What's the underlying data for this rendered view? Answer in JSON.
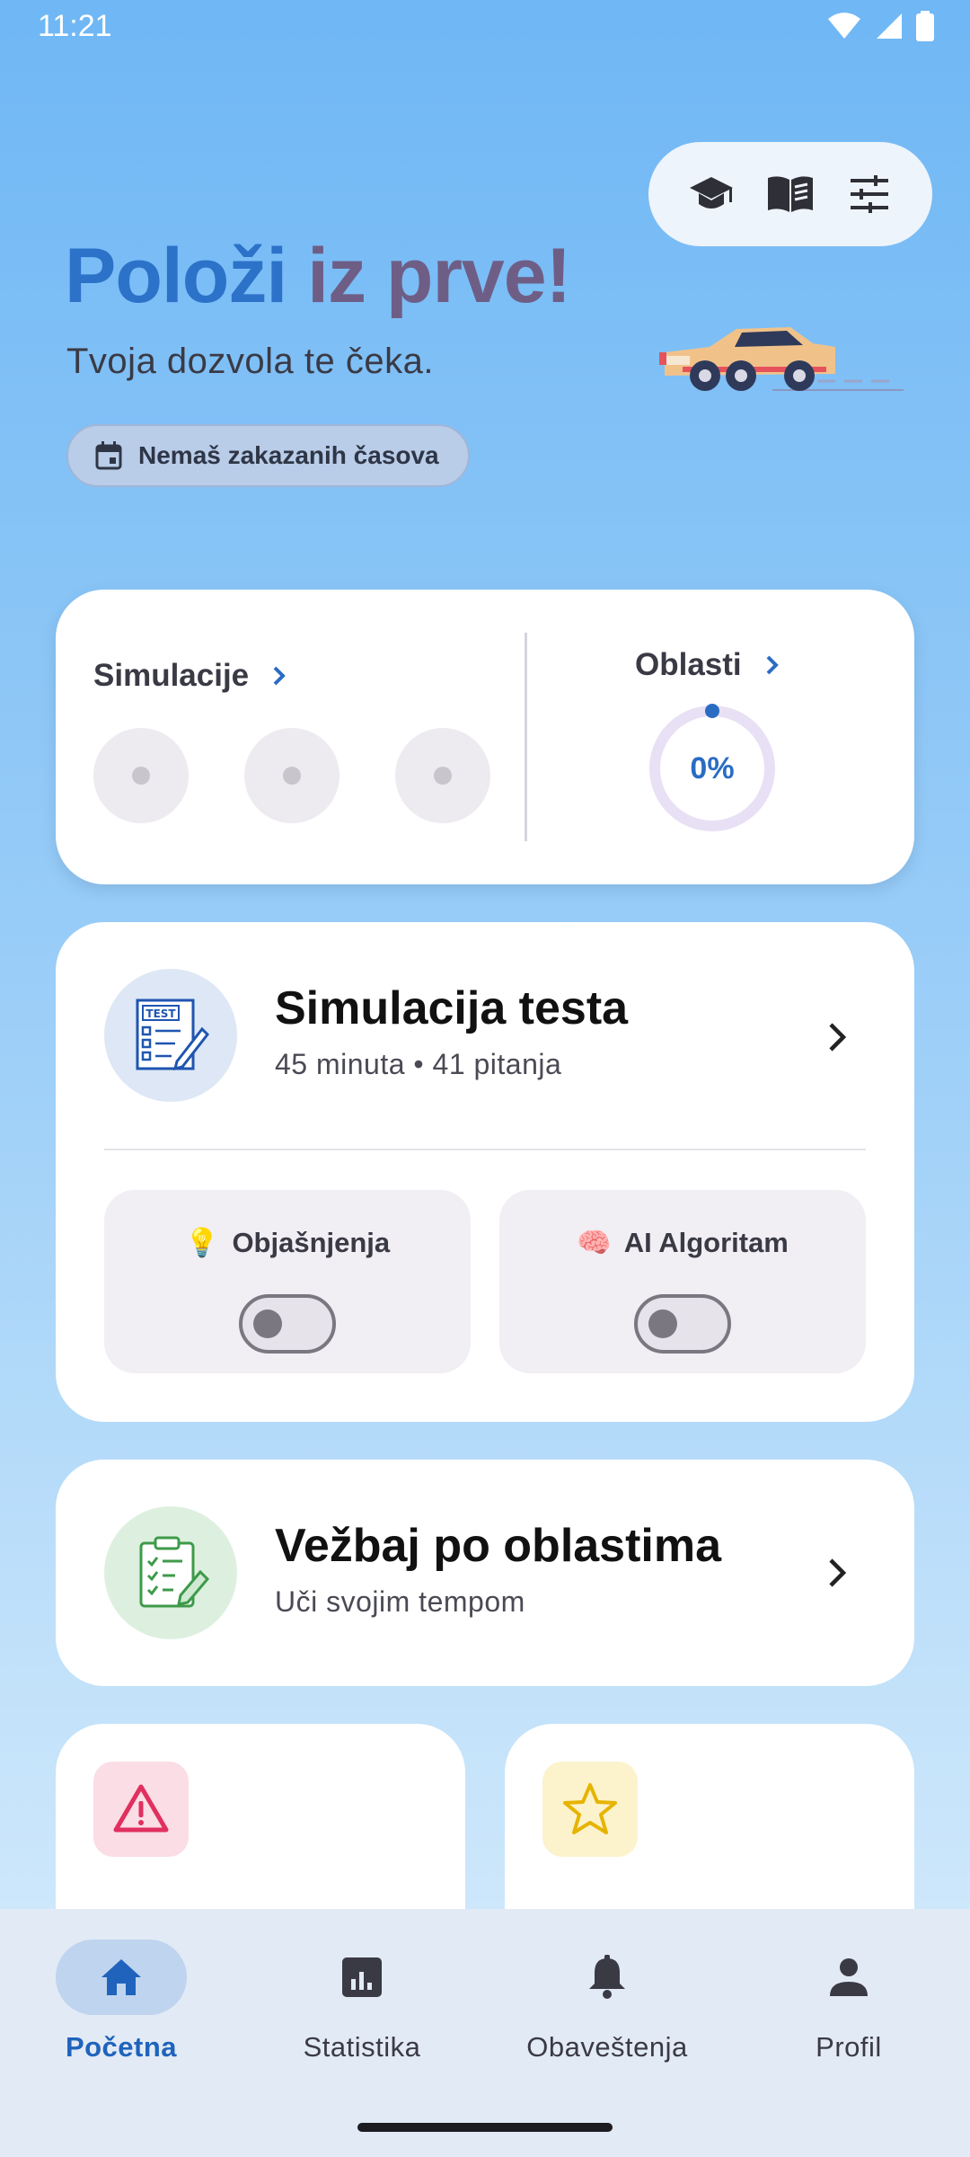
{
  "status_bar": {
    "time": "11:21"
  },
  "hero": {
    "title_part1": "Položi",
    "title_part2": "iz prve!",
    "subtitle": "Tvoja dozvola te čeka.",
    "schedule_chip": "Nemaš zakazanih časova"
  },
  "top_actions": {
    "icons": [
      "graduation-cap-icon",
      "book-icon",
      "tune-icon"
    ]
  },
  "progress_card": {
    "simulations_label": "Simulacije",
    "areas_label": "Oblasti",
    "areas_percent": "0%",
    "areas_progress": 0
  },
  "simulation_card": {
    "title": "Simulacija testa",
    "subtitle": "45 minuta • 41 pitanja",
    "icon_text": "TEST",
    "toggles": [
      {
        "label": "Objašnjenja",
        "emoji": "💡",
        "on": false
      },
      {
        "label": "AI Algoritam",
        "emoji": "🧠",
        "on": false
      }
    ]
  },
  "practice_card": {
    "title": "Vežbaj po oblastima",
    "subtitle": "Uči svojim tempom"
  },
  "bottom_nav": {
    "items": [
      {
        "label": "Početna",
        "icon": "home-icon",
        "active": true
      },
      {
        "label": "Statistika",
        "icon": "bar-chart-icon",
        "active": false
      },
      {
        "label": "Obaveštenja",
        "icon": "bell-icon",
        "active": false
      },
      {
        "label": "Profil",
        "icon": "person-icon",
        "active": false
      }
    ]
  },
  "colors": {
    "accent": "#2C72C9",
    "title_secondary": "#6E5E86",
    "nav_active": "#1F63BC"
  }
}
